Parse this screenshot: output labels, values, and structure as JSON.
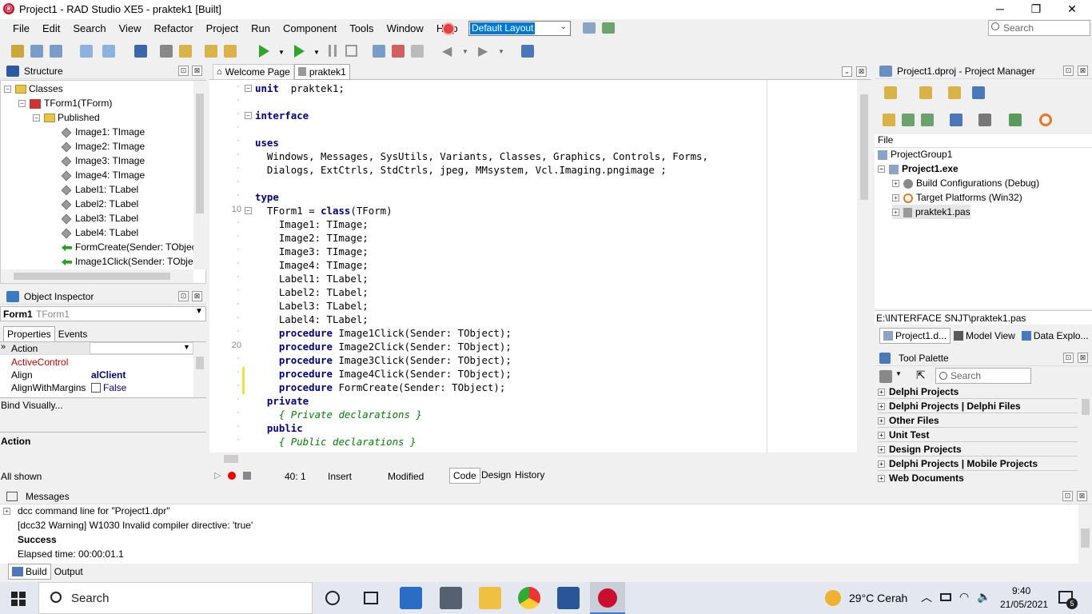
{
  "window": {
    "title": "Project1 - RAD Studio XE5 - praktek1 [Built]",
    "app_icon": "radstudio-icon",
    "minimize": "─",
    "maximize": "❐",
    "close": "✕"
  },
  "menu": [
    "File",
    "Edit",
    "Search",
    "View",
    "Refactor",
    "Project",
    "Run",
    "Component",
    "Tools",
    "Window",
    "Help"
  ],
  "layout": {
    "value": "Default Layout"
  },
  "search": {
    "placeholder": "Search"
  },
  "structure": {
    "title": "Structure",
    "items": [
      {
        "label": "Classes"
      },
      {
        "label": "TForm1(TForm)"
      },
      {
        "label": "Published"
      },
      {
        "label": "Image1: TImage"
      },
      {
        "label": "Image2: TImage"
      },
      {
        "label": "Image3: TImage"
      },
      {
        "label": "Image4: TImage"
      },
      {
        "label": "Label1: TLabel"
      },
      {
        "label": "Label2: TLabel"
      },
      {
        "label": "Label3: TLabel"
      },
      {
        "label": "Label4: TLabel"
      },
      {
        "label": "FormCreate(Sender: TObject)"
      },
      {
        "label": "Image1Click(Sender: TObject)"
      }
    ]
  },
  "inspector": {
    "title": "Object Inspector",
    "object_name": "Form1",
    "object_type": "TForm1",
    "tabs": [
      "Properties",
      "Events"
    ],
    "rows": [
      {
        "name": "Action",
        "value": ""
      },
      {
        "name": "ActiveControl",
        "value": ""
      },
      {
        "name": "Align",
        "value": "alClient"
      },
      {
        "name": "AlignWithMargins",
        "value": "False"
      }
    ],
    "bind_visually": "Bind Visually...",
    "desc_title": "Action",
    "status": "All shown"
  },
  "editor": {
    "tabs": [
      "Welcome Page",
      "praktek1"
    ],
    "lines": [
      {
        "n": "",
        "code": [
          [
            "kw",
            "unit"
          ],
          [
            "",
            "  praktek1;"
          ]
        ]
      },
      {
        "n": "",
        "code": []
      },
      {
        "n": "",
        "code": [
          [
            "kw",
            "interface"
          ]
        ]
      },
      {
        "n": "",
        "code": []
      },
      {
        "n": "",
        "code": [
          [
            "kw",
            "uses"
          ]
        ]
      },
      {
        "n": "",
        "code": [
          [
            "",
            "  Windows, Messages, SysUtils, Variants, Classes, Graphics, Controls, Forms,"
          ]
        ]
      },
      {
        "n": "",
        "code": [
          [
            "",
            "  Dialogs, ExtCtrls, StdCtrls, jpeg, MMsystem, Vcl.Imaging.pngimage ;"
          ]
        ]
      },
      {
        "n": "",
        "code": []
      },
      {
        "n": "",
        "code": [
          [
            "kw",
            "type"
          ]
        ]
      },
      {
        "n": "10",
        "code": [
          [
            "",
            "  TForm1 = "
          ],
          [
            "kw",
            "class"
          ],
          [
            "",
            "(TForm)"
          ]
        ]
      },
      {
        "n": "",
        "code": [
          [
            "",
            "    Image1: TImage;"
          ]
        ]
      },
      {
        "n": "",
        "code": [
          [
            "",
            "    Image2: TImage;"
          ]
        ]
      },
      {
        "n": "",
        "code": [
          [
            "",
            "    Image3: TImage;"
          ]
        ]
      },
      {
        "n": "",
        "code": [
          [
            "",
            "    Image4: TImage;"
          ]
        ]
      },
      {
        "n": "",
        "code": [
          [
            "",
            "    Label1: TLabel;"
          ]
        ]
      },
      {
        "n": "",
        "code": [
          [
            "",
            "    Label2: TLabel;"
          ]
        ]
      },
      {
        "n": "",
        "code": [
          [
            "",
            "    Label3: TLabel;"
          ]
        ]
      },
      {
        "n": "",
        "code": [
          [
            "",
            "    Label4: TLabel;"
          ]
        ]
      },
      {
        "n": "",
        "code": [
          [
            "",
            "    "
          ],
          [
            "kw",
            "procedure"
          ],
          [
            "",
            " Image1Click(Sender: TObject);"
          ]
        ]
      },
      {
        "n": "20",
        "code": [
          [
            "",
            "    "
          ],
          [
            "kw",
            "procedure"
          ],
          [
            "",
            " Image2Click(Sender: TObject);"
          ]
        ]
      },
      {
        "n": "",
        "code": [
          [
            "",
            "    "
          ],
          [
            "kw",
            "procedure"
          ],
          [
            "",
            " Image3Click(Sender: TObject);"
          ]
        ]
      },
      {
        "n": "",
        "code": [
          [
            "",
            "    "
          ],
          [
            "kw",
            "procedure"
          ],
          [
            "",
            " Image4Click(Sender: TObject);"
          ]
        ]
      },
      {
        "n": "",
        "code": [
          [
            "",
            "    "
          ],
          [
            "kw",
            "procedure"
          ],
          [
            "",
            " FormCreate(Sender: TObject);"
          ]
        ]
      },
      {
        "n": "",
        "code": [
          [
            "",
            "  "
          ],
          [
            "kw",
            "private"
          ]
        ]
      },
      {
        "n": "",
        "code": [
          [
            "",
            "    "
          ],
          [
            "cm",
            "{ Private declarations }"
          ]
        ]
      },
      {
        "n": "",
        "code": [
          [
            "",
            "  "
          ],
          [
            "kw",
            "public"
          ]
        ]
      },
      {
        "n": "",
        "code": [
          [
            "",
            "    "
          ],
          [
            "cm",
            "{ Public declarations }"
          ]
        ]
      }
    ],
    "status": {
      "position": "40:  1",
      "mode": "Insert",
      "state": "Modified"
    },
    "view_tabs": [
      "Code",
      "Design",
      "History"
    ]
  },
  "project_manager": {
    "title": "Project1.dproj - Project Manager",
    "col": "File",
    "items": [
      {
        "label": "ProjectGroup1"
      },
      {
        "label": "Project1.exe"
      },
      {
        "label": "Build Configurations (Debug)"
      },
      {
        "label": "Target Platforms (Win32)"
      },
      {
        "label": "praktek1.pas"
      }
    ],
    "path": "E:\\INTERFACE SNJT\\praktek1.pas",
    "tabs": [
      "Project1.d...",
      "Model View",
      "Data Explo..."
    ]
  },
  "tool_palette": {
    "title": "Tool Palette",
    "search_placeholder": "Search",
    "categories": [
      "Delphi Projects",
      "Delphi Projects | Delphi Files",
      "Other Files",
      "Unit Test",
      "Design Projects",
      "Delphi Projects | Mobile Projects",
      "Web Documents"
    ]
  },
  "messages": {
    "title": "Messages",
    "lines": [
      "dcc command line for \"Project1.dpr\"",
      "[dcc32 Warning] W1030 Invalid compiler directive: 'true'",
      "Success",
      "Elapsed time: 00:00:01.1"
    ],
    "tabs": [
      "Build",
      "Output"
    ]
  },
  "taskbar": {
    "search": "Search",
    "weather": "29°C  Cerah",
    "time": "9:40",
    "date": "21/05/2021",
    "notif": "5"
  }
}
